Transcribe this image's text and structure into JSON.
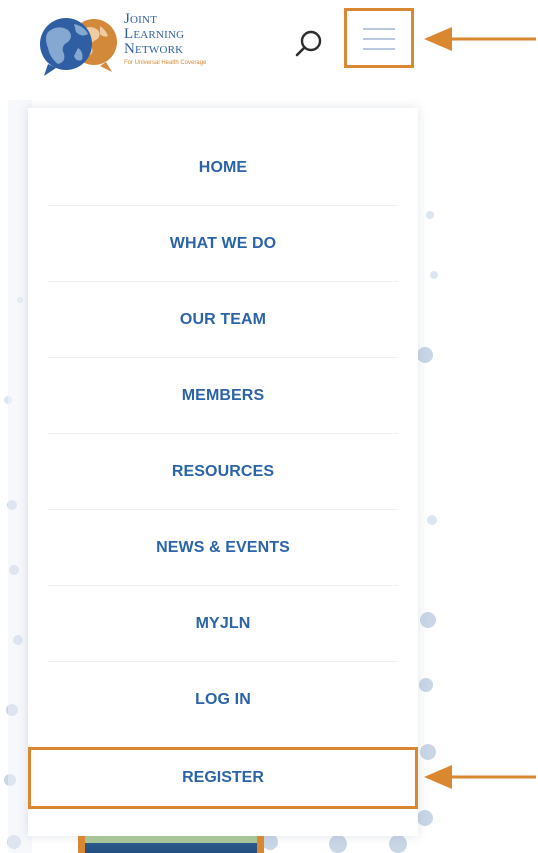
{
  "header": {
    "logo": {
      "line1": "Joint",
      "line2": "Learning",
      "line3": "Network",
      "tagline": "For Universal Health Coverage"
    },
    "search_icon": "search-icon",
    "menu_icon": "hamburger-menu-icon"
  },
  "menu": {
    "items": [
      {
        "label": "HOME"
      },
      {
        "label": "WHAT WE DO"
      },
      {
        "label": "OUR TEAM"
      },
      {
        "label": "MEMBERS"
      },
      {
        "label": "RESOURCES"
      },
      {
        "label": "NEWS & EVENTS"
      },
      {
        "label": "MYJLN"
      },
      {
        "label": "LOG IN"
      }
    ],
    "register_label": "REGISTER"
  },
  "colors": {
    "nav_text": "#2b64a8",
    "highlight": "#d98730",
    "logo_blue": "#2f5fa2",
    "logo_orange": "#d3893a"
  }
}
